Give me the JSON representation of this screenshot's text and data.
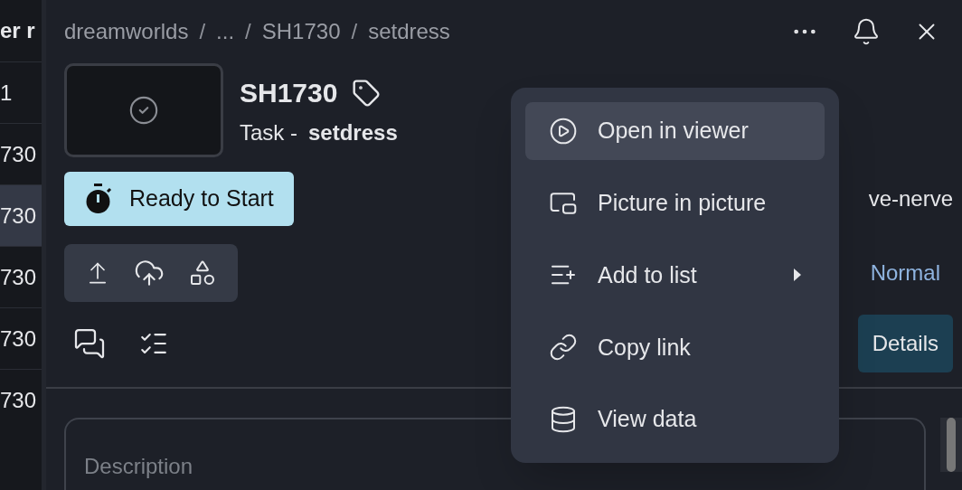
{
  "table": {
    "header": "er r",
    "rows": [
      {
        "text": "1",
        "selected": false
      },
      {
        "text": "730",
        "selected": false
      },
      {
        "text": "730",
        "selected": true
      },
      {
        "text": "730",
        "selected": false
      },
      {
        "text": "730",
        "selected": false
      },
      {
        "text": "730",
        "selected": false
      }
    ]
  },
  "breadcrumb": [
    {
      "kind": "item",
      "text": "dreamworlds"
    },
    {
      "kind": "separator",
      "text": "/"
    },
    {
      "kind": "item",
      "text": "..."
    },
    {
      "kind": "separator",
      "text": "/"
    },
    {
      "kind": "item",
      "text": "SH1730"
    },
    {
      "kind": "separator",
      "text": "/"
    },
    {
      "kind": "item",
      "text": "setdress"
    }
  ],
  "entity": {
    "title": "SH1730",
    "type_label": "Task -",
    "type_value": "setdress"
  },
  "status": {
    "label": "Ready to Start"
  },
  "assignee": "ve-nerve",
  "priority": "Normal",
  "details_button": "Details",
  "description": {
    "placeholder": "Description"
  },
  "menu": [
    {
      "kind": "play",
      "label": "Open in viewer",
      "selected": true,
      "submenu": false
    },
    {
      "kind": "pip",
      "label": "Picture in picture",
      "selected": false,
      "submenu": false
    },
    {
      "kind": "list",
      "label": "Add to list",
      "selected": false,
      "submenu": true
    },
    {
      "kind": "link",
      "label": "Copy link",
      "selected": false,
      "submenu": false
    },
    {
      "kind": "data",
      "label": "View data",
      "selected": false,
      "submenu": false
    }
  ]
}
